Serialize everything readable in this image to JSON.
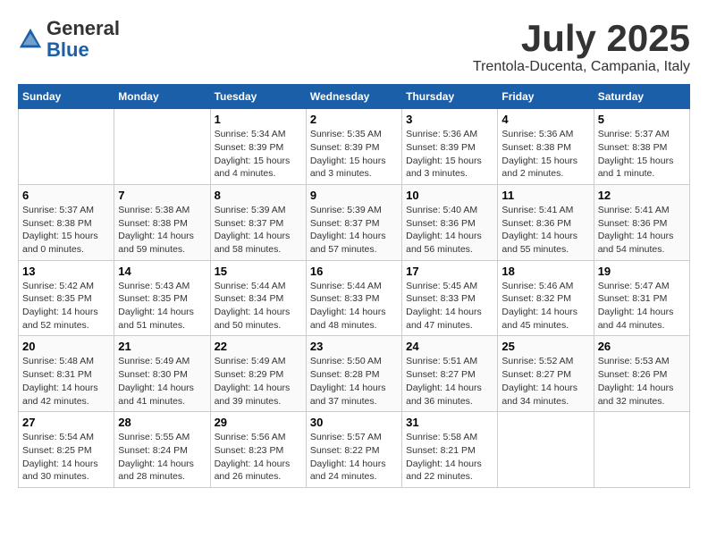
{
  "header": {
    "logo_line1": "General",
    "logo_line2": "Blue",
    "month": "July 2025",
    "location": "Trentola-Ducenta, Campania, Italy"
  },
  "weekdays": [
    "Sunday",
    "Monday",
    "Tuesday",
    "Wednesday",
    "Thursday",
    "Friday",
    "Saturday"
  ],
  "weeks": [
    [
      {
        "day": "",
        "info": ""
      },
      {
        "day": "",
        "info": ""
      },
      {
        "day": "1",
        "info": "Sunrise: 5:34 AM\nSunset: 8:39 PM\nDaylight: 15 hours and 4 minutes."
      },
      {
        "day": "2",
        "info": "Sunrise: 5:35 AM\nSunset: 8:39 PM\nDaylight: 15 hours and 3 minutes."
      },
      {
        "day": "3",
        "info": "Sunrise: 5:36 AM\nSunset: 8:39 PM\nDaylight: 15 hours and 3 minutes."
      },
      {
        "day": "4",
        "info": "Sunrise: 5:36 AM\nSunset: 8:38 PM\nDaylight: 15 hours and 2 minutes."
      },
      {
        "day": "5",
        "info": "Sunrise: 5:37 AM\nSunset: 8:38 PM\nDaylight: 15 hours and 1 minute."
      }
    ],
    [
      {
        "day": "6",
        "info": "Sunrise: 5:37 AM\nSunset: 8:38 PM\nDaylight: 15 hours and 0 minutes."
      },
      {
        "day": "7",
        "info": "Sunrise: 5:38 AM\nSunset: 8:38 PM\nDaylight: 14 hours and 59 minutes."
      },
      {
        "day": "8",
        "info": "Sunrise: 5:39 AM\nSunset: 8:37 PM\nDaylight: 14 hours and 58 minutes."
      },
      {
        "day": "9",
        "info": "Sunrise: 5:39 AM\nSunset: 8:37 PM\nDaylight: 14 hours and 57 minutes."
      },
      {
        "day": "10",
        "info": "Sunrise: 5:40 AM\nSunset: 8:36 PM\nDaylight: 14 hours and 56 minutes."
      },
      {
        "day": "11",
        "info": "Sunrise: 5:41 AM\nSunset: 8:36 PM\nDaylight: 14 hours and 55 minutes."
      },
      {
        "day": "12",
        "info": "Sunrise: 5:41 AM\nSunset: 8:36 PM\nDaylight: 14 hours and 54 minutes."
      }
    ],
    [
      {
        "day": "13",
        "info": "Sunrise: 5:42 AM\nSunset: 8:35 PM\nDaylight: 14 hours and 52 minutes."
      },
      {
        "day": "14",
        "info": "Sunrise: 5:43 AM\nSunset: 8:35 PM\nDaylight: 14 hours and 51 minutes."
      },
      {
        "day": "15",
        "info": "Sunrise: 5:44 AM\nSunset: 8:34 PM\nDaylight: 14 hours and 50 minutes."
      },
      {
        "day": "16",
        "info": "Sunrise: 5:44 AM\nSunset: 8:33 PM\nDaylight: 14 hours and 48 minutes."
      },
      {
        "day": "17",
        "info": "Sunrise: 5:45 AM\nSunset: 8:33 PM\nDaylight: 14 hours and 47 minutes."
      },
      {
        "day": "18",
        "info": "Sunrise: 5:46 AM\nSunset: 8:32 PM\nDaylight: 14 hours and 45 minutes."
      },
      {
        "day": "19",
        "info": "Sunrise: 5:47 AM\nSunset: 8:31 PM\nDaylight: 14 hours and 44 minutes."
      }
    ],
    [
      {
        "day": "20",
        "info": "Sunrise: 5:48 AM\nSunset: 8:31 PM\nDaylight: 14 hours and 42 minutes."
      },
      {
        "day": "21",
        "info": "Sunrise: 5:49 AM\nSunset: 8:30 PM\nDaylight: 14 hours and 41 minutes."
      },
      {
        "day": "22",
        "info": "Sunrise: 5:49 AM\nSunset: 8:29 PM\nDaylight: 14 hours and 39 minutes."
      },
      {
        "day": "23",
        "info": "Sunrise: 5:50 AM\nSunset: 8:28 PM\nDaylight: 14 hours and 37 minutes."
      },
      {
        "day": "24",
        "info": "Sunrise: 5:51 AM\nSunset: 8:27 PM\nDaylight: 14 hours and 36 minutes."
      },
      {
        "day": "25",
        "info": "Sunrise: 5:52 AM\nSunset: 8:27 PM\nDaylight: 14 hours and 34 minutes."
      },
      {
        "day": "26",
        "info": "Sunrise: 5:53 AM\nSunset: 8:26 PM\nDaylight: 14 hours and 32 minutes."
      }
    ],
    [
      {
        "day": "27",
        "info": "Sunrise: 5:54 AM\nSunset: 8:25 PM\nDaylight: 14 hours and 30 minutes."
      },
      {
        "day": "28",
        "info": "Sunrise: 5:55 AM\nSunset: 8:24 PM\nDaylight: 14 hours and 28 minutes."
      },
      {
        "day": "29",
        "info": "Sunrise: 5:56 AM\nSunset: 8:23 PM\nDaylight: 14 hours and 26 minutes."
      },
      {
        "day": "30",
        "info": "Sunrise: 5:57 AM\nSunset: 8:22 PM\nDaylight: 14 hours and 24 minutes."
      },
      {
        "day": "31",
        "info": "Sunrise: 5:58 AM\nSunset: 8:21 PM\nDaylight: 14 hours and 22 minutes."
      },
      {
        "day": "",
        "info": ""
      },
      {
        "day": "",
        "info": ""
      }
    ]
  ]
}
